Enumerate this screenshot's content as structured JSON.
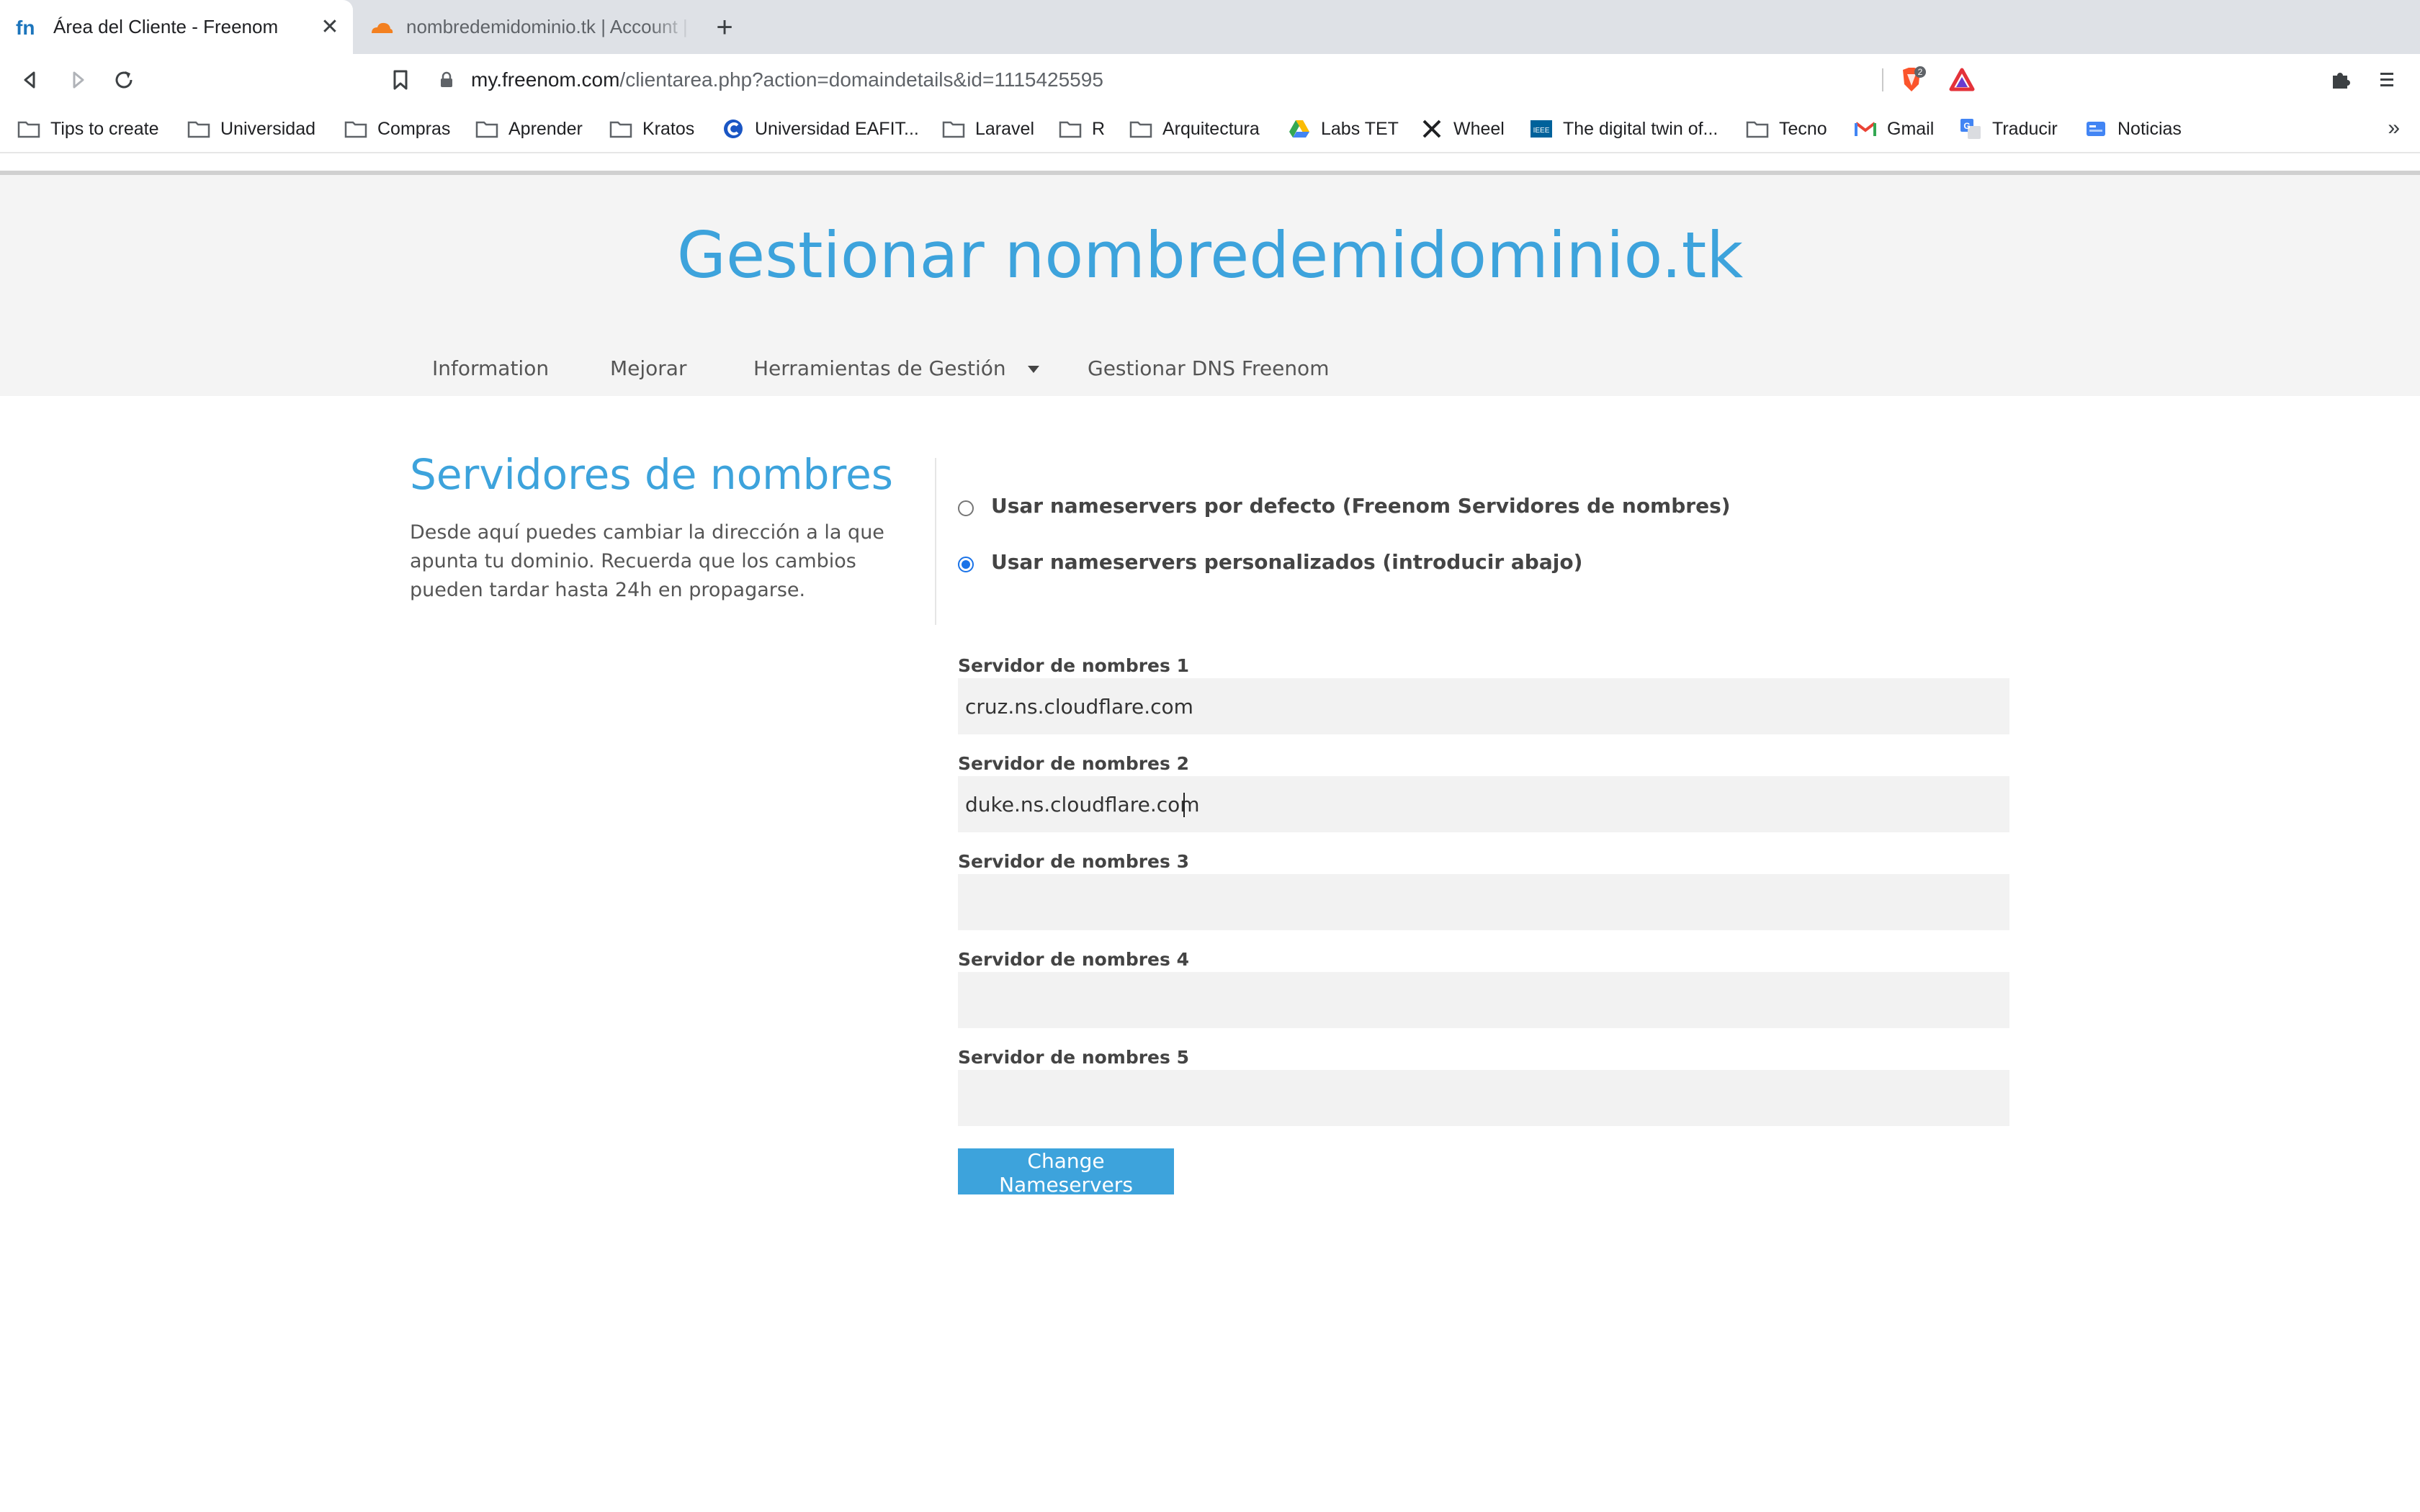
{
  "browser": {
    "tabs": [
      {
        "title": "Área del Cliente - Freenom",
        "active": true
      },
      {
        "title": "nombredemidominio.tk | Account | C",
        "active": false
      }
    ],
    "url": {
      "host": "my.freenom.com",
      "path": "/clientarea.php?action=domaindetails&id=1115425595"
    },
    "brave_badge": "2",
    "bookmarks": [
      {
        "label": "Tips to create",
        "icon": "folder-icon"
      },
      {
        "label": "Universidad",
        "icon": "folder-icon"
      },
      {
        "label": "Compras",
        "icon": "folder-icon"
      },
      {
        "label": "Aprender",
        "icon": "folder-icon"
      },
      {
        "label": "Kratos",
        "icon": "folder-icon"
      },
      {
        "label": "Universidad EAFIT...",
        "icon": "eafit-icon"
      },
      {
        "label": "Laravel",
        "icon": "folder-icon"
      },
      {
        "label": "R",
        "icon": "folder-icon"
      },
      {
        "label": "Arquitectura",
        "icon": "folder-icon"
      },
      {
        "label": "Labs TET",
        "icon": "drive-icon"
      },
      {
        "label": "Wheel",
        "icon": "tools-icon"
      },
      {
        "label": "The digital twin of...",
        "icon": "ieee-icon"
      },
      {
        "label": "Tecno",
        "icon": "folder-icon"
      },
      {
        "label": "Gmail",
        "icon": "gmail-icon"
      },
      {
        "label": "Traducir",
        "icon": "translate-icon"
      },
      {
        "label": "Noticias",
        "icon": "news-icon"
      }
    ],
    "more_bookmarks": "»"
  },
  "page": {
    "heading": "Gestionar nombredemidominio.tk",
    "subnav": {
      "information": "Information",
      "mejorar": "Mejorar",
      "herramientas": "Herramientas de Gestión",
      "dns": "Gestionar DNS Freenom"
    },
    "section": {
      "title": "Servidores de nombres",
      "description": "Desde aquí puedes cambiar la dirección a la que apunta tu dominio. Recuerda que los cambios pueden tardar hasta 24h en propagarse."
    },
    "options": {
      "default_label": "Usar nameservers por defecto (Freenom Servidores de nombres)",
      "custom_label": "Usar nameservers personalizados (introducir abajo)",
      "selected": "custom"
    },
    "nameservers": [
      {
        "label": "Servidor de nombres 1",
        "value": "cruz.ns.cloudflare.com"
      },
      {
        "label": "Servidor de nombres 2",
        "value": "duke.ns.cloudflare.com"
      },
      {
        "label": "Servidor de nombres 3",
        "value": ""
      },
      {
        "label": "Servidor de nombres 4",
        "value": ""
      },
      {
        "label": "Servidor de nombres 5",
        "value": ""
      }
    ],
    "submit_label": "Change Nameservers",
    "colors": {
      "accent": "#3da3dc",
      "hero_bg": "#f4f4f4",
      "input_bg": "#f2f2f2"
    }
  }
}
